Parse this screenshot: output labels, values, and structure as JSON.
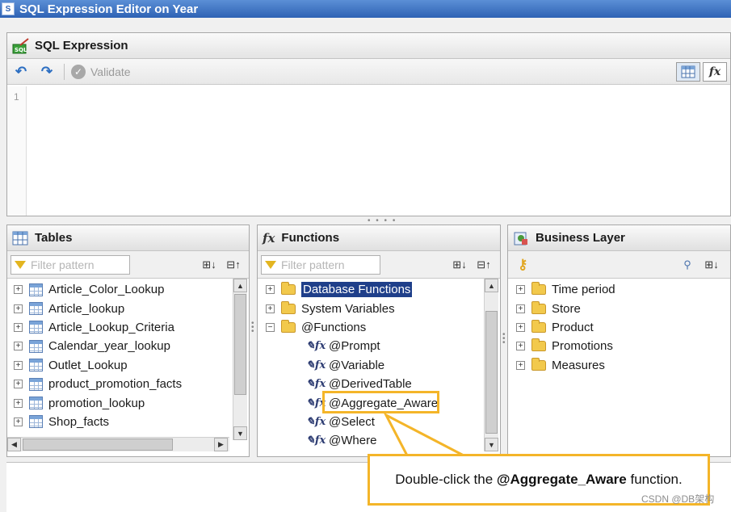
{
  "window": {
    "title": "SQL Expression Editor on Year"
  },
  "sql_panel": {
    "header": "SQL Expression",
    "validate_label": "Validate",
    "line_number": "1",
    "fx_label": "fx"
  },
  "tables": {
    "header": "Tables",
    "filter_placeholder": "Filter pattern",
    "items": [
      "Article_Color_Lookup",
      "Article_lookup",
      "Article_Lookup_Criteria",
      "Calendar_year_lookup",
      "Outlet_Lookup",
      "product_promotion_facts",
      "promotion_lookup",
      "Shop_facts"
    ]
  },
  "functions": {
    "header": "Functions",
    "header_icon": "fx",
    "filter_placeholder": "Filter pattern",
    "folders": [
      "Database Functions",
      "System Variables",
      "@Functions"
    ],
    "children": [
      "@Prompt",
      "@Variable",
      "@DerivedTable",
      "@Aggregate_Aware",
      "@Select",
      "@Where"
    ]
  },
  "business_layer": {
    "header": "Business Layer",
    "folders": [
      "Time period",
      "Store",
      "Product",
      "Promotions",
      "Measures"
    ]
  },
  "callout": {
    "prefix": "Double-click the ",
    "emphasis": "@Aggregate_Aware",
    "suffix": " function."
  },
  "watermark": "CSDN @DB架构",
  "colors": {
    "highlight": "#f4b529",
    "selection": "#1f3f8a"
  }
}
